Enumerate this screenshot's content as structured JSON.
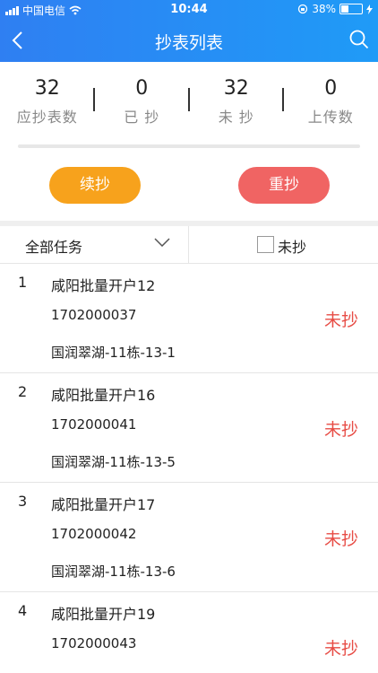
{
  "status_bar": {
    "carrier": "中国电信",
    "time": "10:44",
    "battery": "38%",
    "battery_level": 0.38
  },
  "nav": {
    "title": "抄表列表"
  },
  "stats": [
    {
      "value": "32",
      "label": "应抄表数"
    },
    {
      "value": "0",
      "label": "已 抄"
    },
    {
      "value": "32",
      "label": "未 抄"
    },
    {
      "value": "0",
      "label": "上传数"
    }
  ],
  "buttons": {
    "continue": "续抄",
    "redo": "重抄"
  },
  "filter": {
    "task": "全部任务",
    "unread_label": "未抄"
  },
  "colors": {
    "header": "#2f7ff2",
    "continue": "#f7a21c",
    "redo": "#f06463",
    "status_text": "#e74c45"
  },
  "items": [
    {
      "index": "1",
      "name": "咸阳批量开户12",
      "code": "1702000037",
      "address": "国润翠湖-11栋-13-1",
      "status": "未抄"
    },
    {
      "index": "2",
      "name": "咸阳批量开户16",
      "code": "1702000041",
      "address": "国润翠湖-11栋-13-5",
      "status": "未抄"
    },
    {
      "index": "3",
      "name": "咸阳批量开户17",
      "code": "1702000042",
      "address": "国润翠湖-11栋-13-6",
      "status": "未抄"
    },
    {
      "index": "4",
      "name": "咸阳批量开户19",
      "code": "1702000043",
      "address": "",
      "status": "未抄"
    }
  ]
}
